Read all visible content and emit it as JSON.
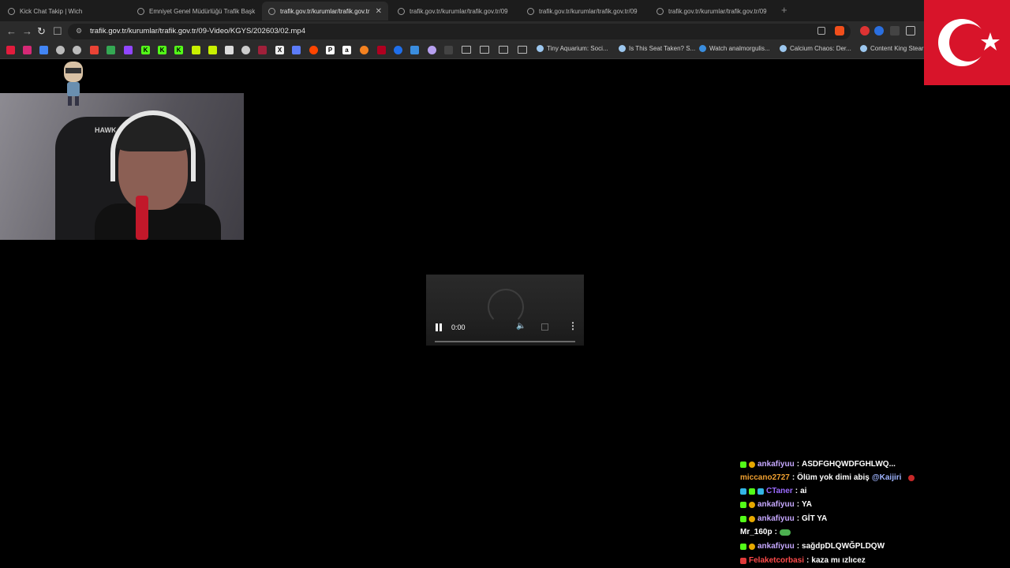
{
  "tabs": [
    {
      "label": "Kick Chat Takip | Wich",
      "active": false
    },
    {
      "label": "Emniyet Genel Müdürlüğü Trafik Başk",
      "active": false
    },
    {
      "label": "trafik.gov.tr/kurumlar/trafik.gov.tr",
      "active": true
    },
    {
      "label": "trafik.gov.tr/kurumlar/trafik.gov.tr/09",
      "active": false
    },
    {
      "label": "trafik.gov.tr/kurumlar/trafik.gov.tr/09",
      "active": false
    },
    {
      "label": "trafik.gov.tr/kurumlar/trafik.gov.tr/09",
      "active": false
    }
  ],
  "new_tab_label": "+",
  "address_bar": {
    "url": "trafik.gov.tr/kurumlar/trafik.gov.tr/09-Video/KGYS/202603/02.mp4"
  },
  "nav": {
    "back": "←",
    "forward": "→",
    "reload": "↻",
    "bookmark": "☐"
  },
  "bookmarks": {
    "named": [
      "Tiny Aquarium: Soci...",
      "Is This Seat Taken? S...",
      "Watch analmorgulis...",
      "Calcium Chaos: Der...",
      "Content King Stear"
    ],
    "letters": [
      "K",
      "K",
      "K",
      "X",
      "P",
      "a"
    ]
  },
  "player": {
    "time": "0:00",
    "state": "paused-loading",
    "progress": 0
  },
  "chat": [
    {
      "user": "ankafiyuu",
      "sep": ":",
      "text": "ASDFGHQWDFGHLWQ...",
      "color": "#c6a8ff",
      "badges": [
        "#3a7",
        "#e6a800"
      ],
      "cut": true
    },
    {
      "user": "miccano2727",
      "sep": ":",
      "text": "Ölüm yok dimi abiş",
      "mention": "@Kaijiri",
      "color": "#f0a030",
      "badges": []
    },
    {
      "user": "CTaner",
      "sep": ":",
      "text": "ai",
      "color": "#9b6bff",
      "badges": [
        "#33b5e5",
        "#53fc18",
        "#33b5e5"
      ]
    },
    {
      "user": "ankafiyuu",
      "sep": ":",
      "text": "YA",
      "color": "#c6a8ff",
      "badges": [
        "#53fc18",
        "#e6a800"
      ]
    },
    {
      "user": "ankafiyuu",
      "sep": ":",
      "text": "GİT YA",
      "color": "#c6a8ff",
      "badges": [
        "#53fc18",
        "#e6a800"
      ]
    },
    {
      "user": "Mr_160p",
      "sep": ":",
      "text": "",
      "color": "#ffffff",
      "badges": [],
      "emote": true
    },
    {
      "user": "ankafiyuu",
      "sep": ":",
      "text": "sağdpDLQWĞPLDQW",
      "color": "#c6a8ff",
      "badges": [
        "#53fc18",
        "#e6a800"
      ]
    },
    {
      "user": "Felaketcorbasi",
      "sep": ":",
      "text": "kaza mı ızlıcez",
      "color": "#ff4a4a",
      "badges": [
        "#e03a3a"
      ]
    }
  ],
  "webcam": {
    "chair_brand": "HAWK"
  },
  "colors": {
    "flag_red": "#d8142a",
    "tab_bg": "#1c1c1c",
    "toolbar_bg": "#2b2b2b"
  }
}
